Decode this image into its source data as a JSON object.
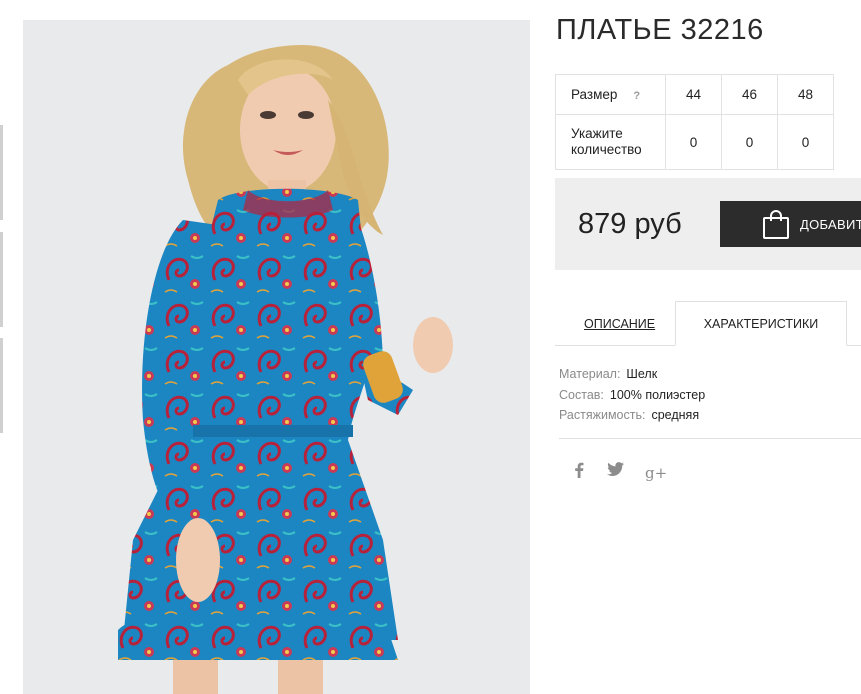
{
  "product": {
    "title": "ПЛАТЬЕ 32216",
    "photo_alt": "Blonde model in blue paisley print dress"
  },
  "sizes": {
    "size_label": "Размер",
    "help_symbol": "?",
    "qty_label": "Укажите количество",
    "items": [
      {
        "size": "44",
        "qty": "0"
      },
      {
        "size": "46",
        "qty": "0"
      },
      {
        "size": "48",
        "qty": "0"
      }
    ]
  },
  "price": {
    "value": "879 руб",
    "button_label": "ДОБАВИТЬ В КОРЗИНУ"
  },
  "tabs": [
    {
      "label": "ОПИСАНИЕ",
      "active": false
    },
    {
      "label": "ХАРАКТЕРИСТИКИ",
      "active": true
    }
  ],
  "characteristics": [
    {
      "key": "Материал:",
      "value": "Шелк"
    },
    {
      "key": "Состав:",
      "value": "100% полиэстер"
    },
    {
      "key": "Растяжимость:",
      "value": "средняя"
    }
  ],
  "social": [
    {
      "name": "facebook-icon",
      "glyph": "f"
    },
    {
      "name": "twitter-icon",
      "glyph": "t"
    },
    {
      "name": "google-plus-icon",
      "glyph": "g+"
    }
  ],
  "colors": {
    "dress_blue": "#1b86c2",
    "paisley_red": "#b8213a",
    "button_dark": "#2c2c2c",
    "price_box_bg": "#eeeeee",
    "photo_bg": "#e9eaec"
  }
}
